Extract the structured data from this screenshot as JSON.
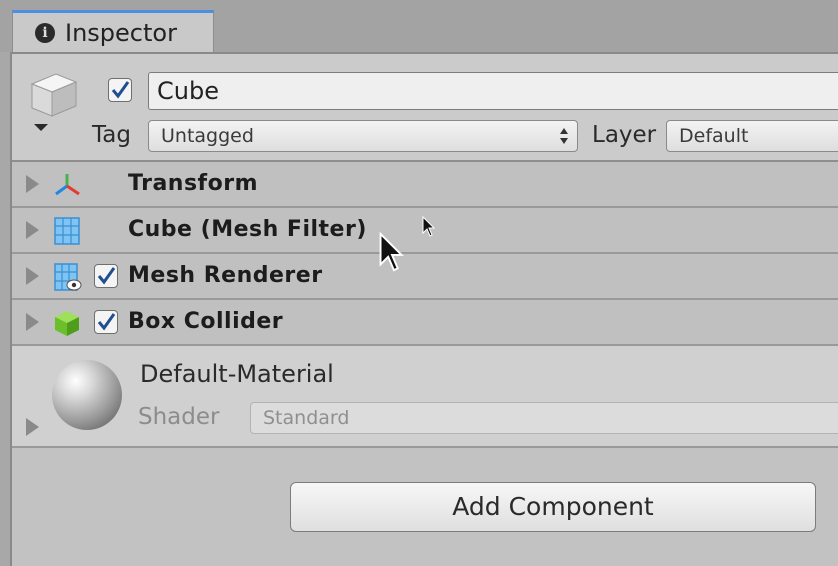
{
  "window": {
    "tab_label": "Inspector",
    "tab_icon": "info-icon"
  },
  "gameobject": {
    "name": "Cube",
    "active": true,
    "tag_label": "Tag",
    "tag_value": "Untagged",
    "layer_label": "Layer",
    "layer_value": "Default"
  },
  "components": [
    {
      "label": "Transform",
      "icon": "transform-icon",
      "has_checkbox": false
    },
    {
      "label": "Cube (Mesh Filter)",
      "icon": "mesh-filter-icon",
      "has_checkbox": false
    },
    {
      "label": "Mesh Renderer",
      "icon": "mesh-renderer-icon",
      "has_checkbox": true,
      "enabled": true
    },
    {
      "label": "Box Collider",
      "icon": "box-collider-icon",
      "has_checkbox": true,
      "enabled": true
    }
  ],
  "material": {
    "name": "Default-Material",
    "shader_label": "Shader",
    "shader_value": "Standard"
  },
  "add_component_label": "Add Component",
  "colors": {
    "tab_accent": "#4a8fe0",
    "panel_bg": "#c2c2c2",
    "check": "#1f4f8f"
  }
}
